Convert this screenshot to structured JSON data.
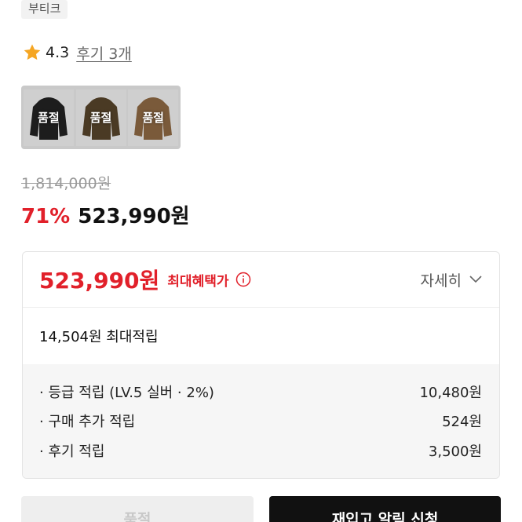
{
  "brand_tag": "부티크",
  "rating": {
    "value": "4.3",
    "reviews_label": "후기 3개",
    "icon": "star-icon",
    "star_color": "#f5a623"
  },
  "thumbnails": [
    {
      "label": "품절",
      "color": "#1d1d1d"
    },
    {
      "label": "품절",
      "color": "#4a3a24"
    },
    {
      "label": "품절",
      "color": "#7a5a3a"
    }
  ],
  "pricing": {
    "original": "1,814,000원",
    "discount": "71%",
    "sale": "523,990원"
  },
  "benefit": {
    "max_price": "523,990원",
    "max_label": "최대혜택가",
    "detail_label": "자세히",
    "points_summary": "14,504원 최대적립",
    "items": [
      {
        "label": "· 등급 적립 (LV.5 실버 · 2%)",
        "value": "10,480원"
      },
      {
        "label": "· 구매 추가 적립",
        "value": "524원"
      },
      {
        "label": "· 후기 적립",
        "value": "3,500원"
      }
    ]
  },
  "actions": {
    "soldout_button": "품절",
    "restock_button": "재입고 알림 신청"
  },
  "colors": {
    "accent_red": "#e1202a",
    "dark": "#111111"
  }
}
